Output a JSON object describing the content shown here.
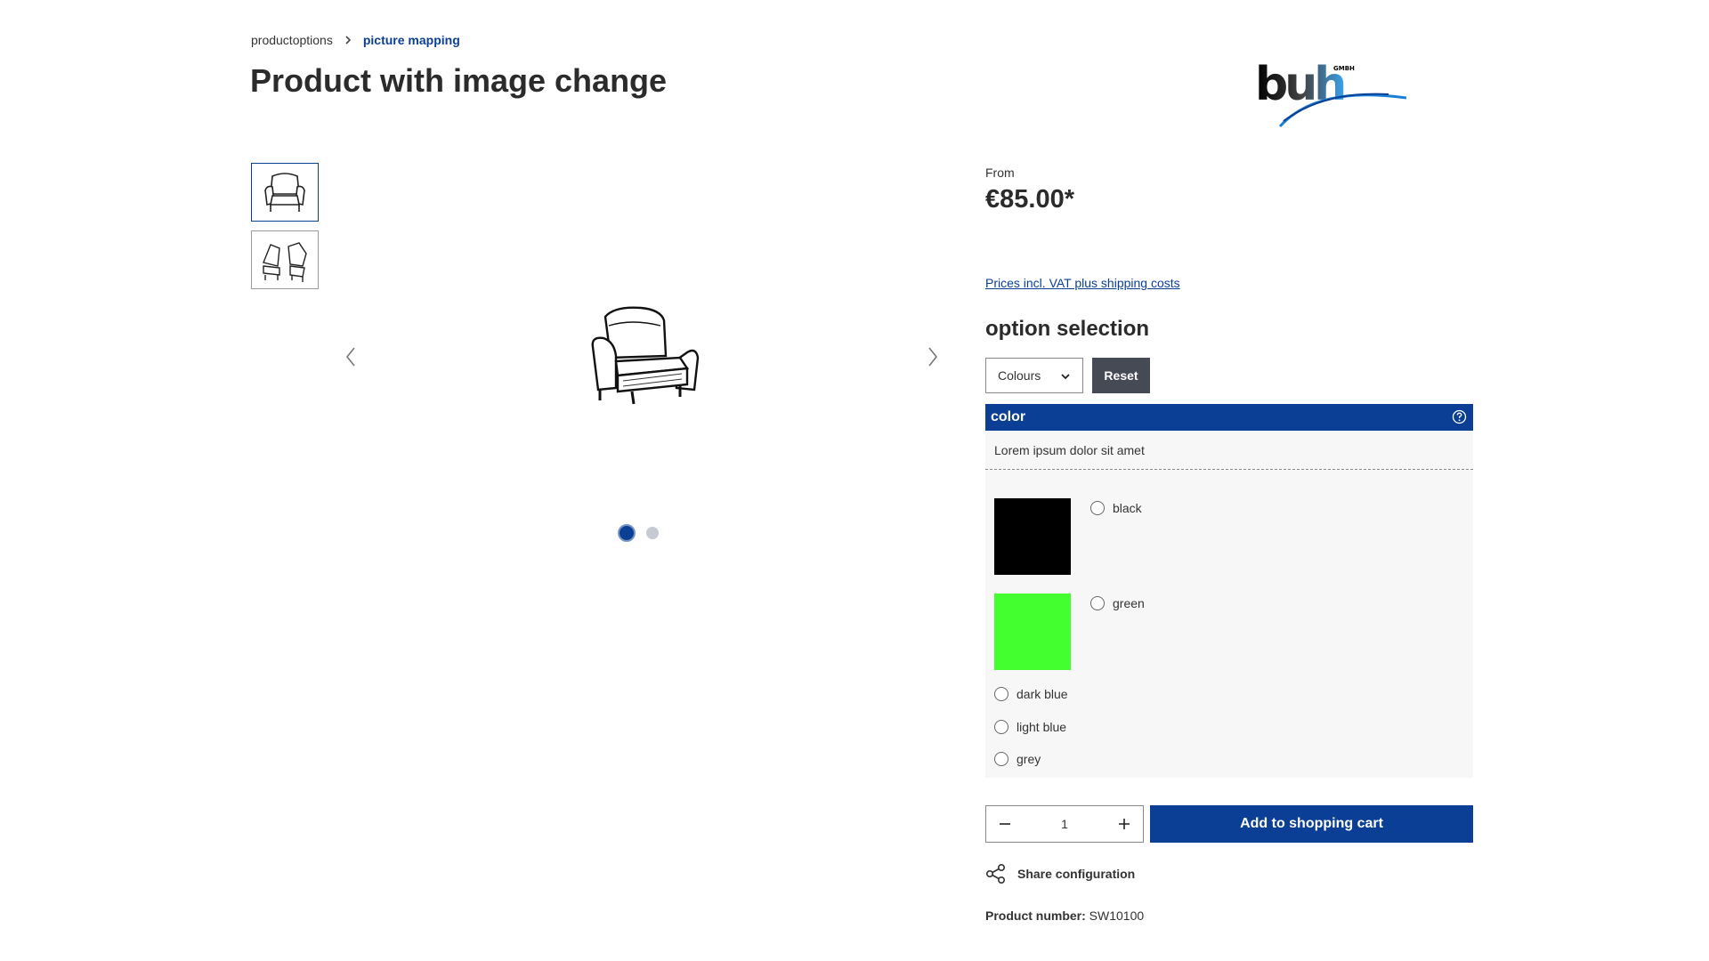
{
  "breadcrumb": {
    "items": [
      "productoptions",
      "picture mapping"
    ]
  },
  "page": {
    "title": "Product with image change"
  },
  "logo": {
    "text": "buh",
    "suffix": "GMBH"
  },
  "gallery": {
    "thumbnails": [
      "armchair front view",
      "armchair side views"
    ],
    "active_thumbnail": 0,
    "slide_count": 2,
    "active_slide": 0,
    "prev_icon": "chevron-left-icon",
    "next_icon": "chevron-right-icon"
  },
  "buybox": {
    "price_prefix": "From",
    "price": "€85.00*",
    "vat_link": "Prices incl. VAT plus shipping costs",
    "option_title": "option selection",
    "select": {
      "selected": "Colours"
    },
    "reset_label": "Reset",
    "panel": {
      "title": "color",
      "description": "Lorem ipsum dolor sit amet",
      "swatch_options": [
        {
          "label": "black",
          "color": "#000000"
        },
        {
          "label": "green",
          "color": "#44ff2f"
        }
      ],
      "list_options": [
        {
          "label": "dark blue"
        },
        {
          "label": "light blue"
        },
        {
          "label": "grey"
        }
      ]
    },
    "quantity": "1",
    "cart_label": "Add to shopping cart",
    "share_label": "Share configuration",
    "product_number_label": "Product number:",
    "product_number": "SW10100"
  },
  "colors": {
    "accent": "#0b3f96",
    "reset_bg": "#454a54",
    "panel_bg": "#f7f7f7"
  }
}
